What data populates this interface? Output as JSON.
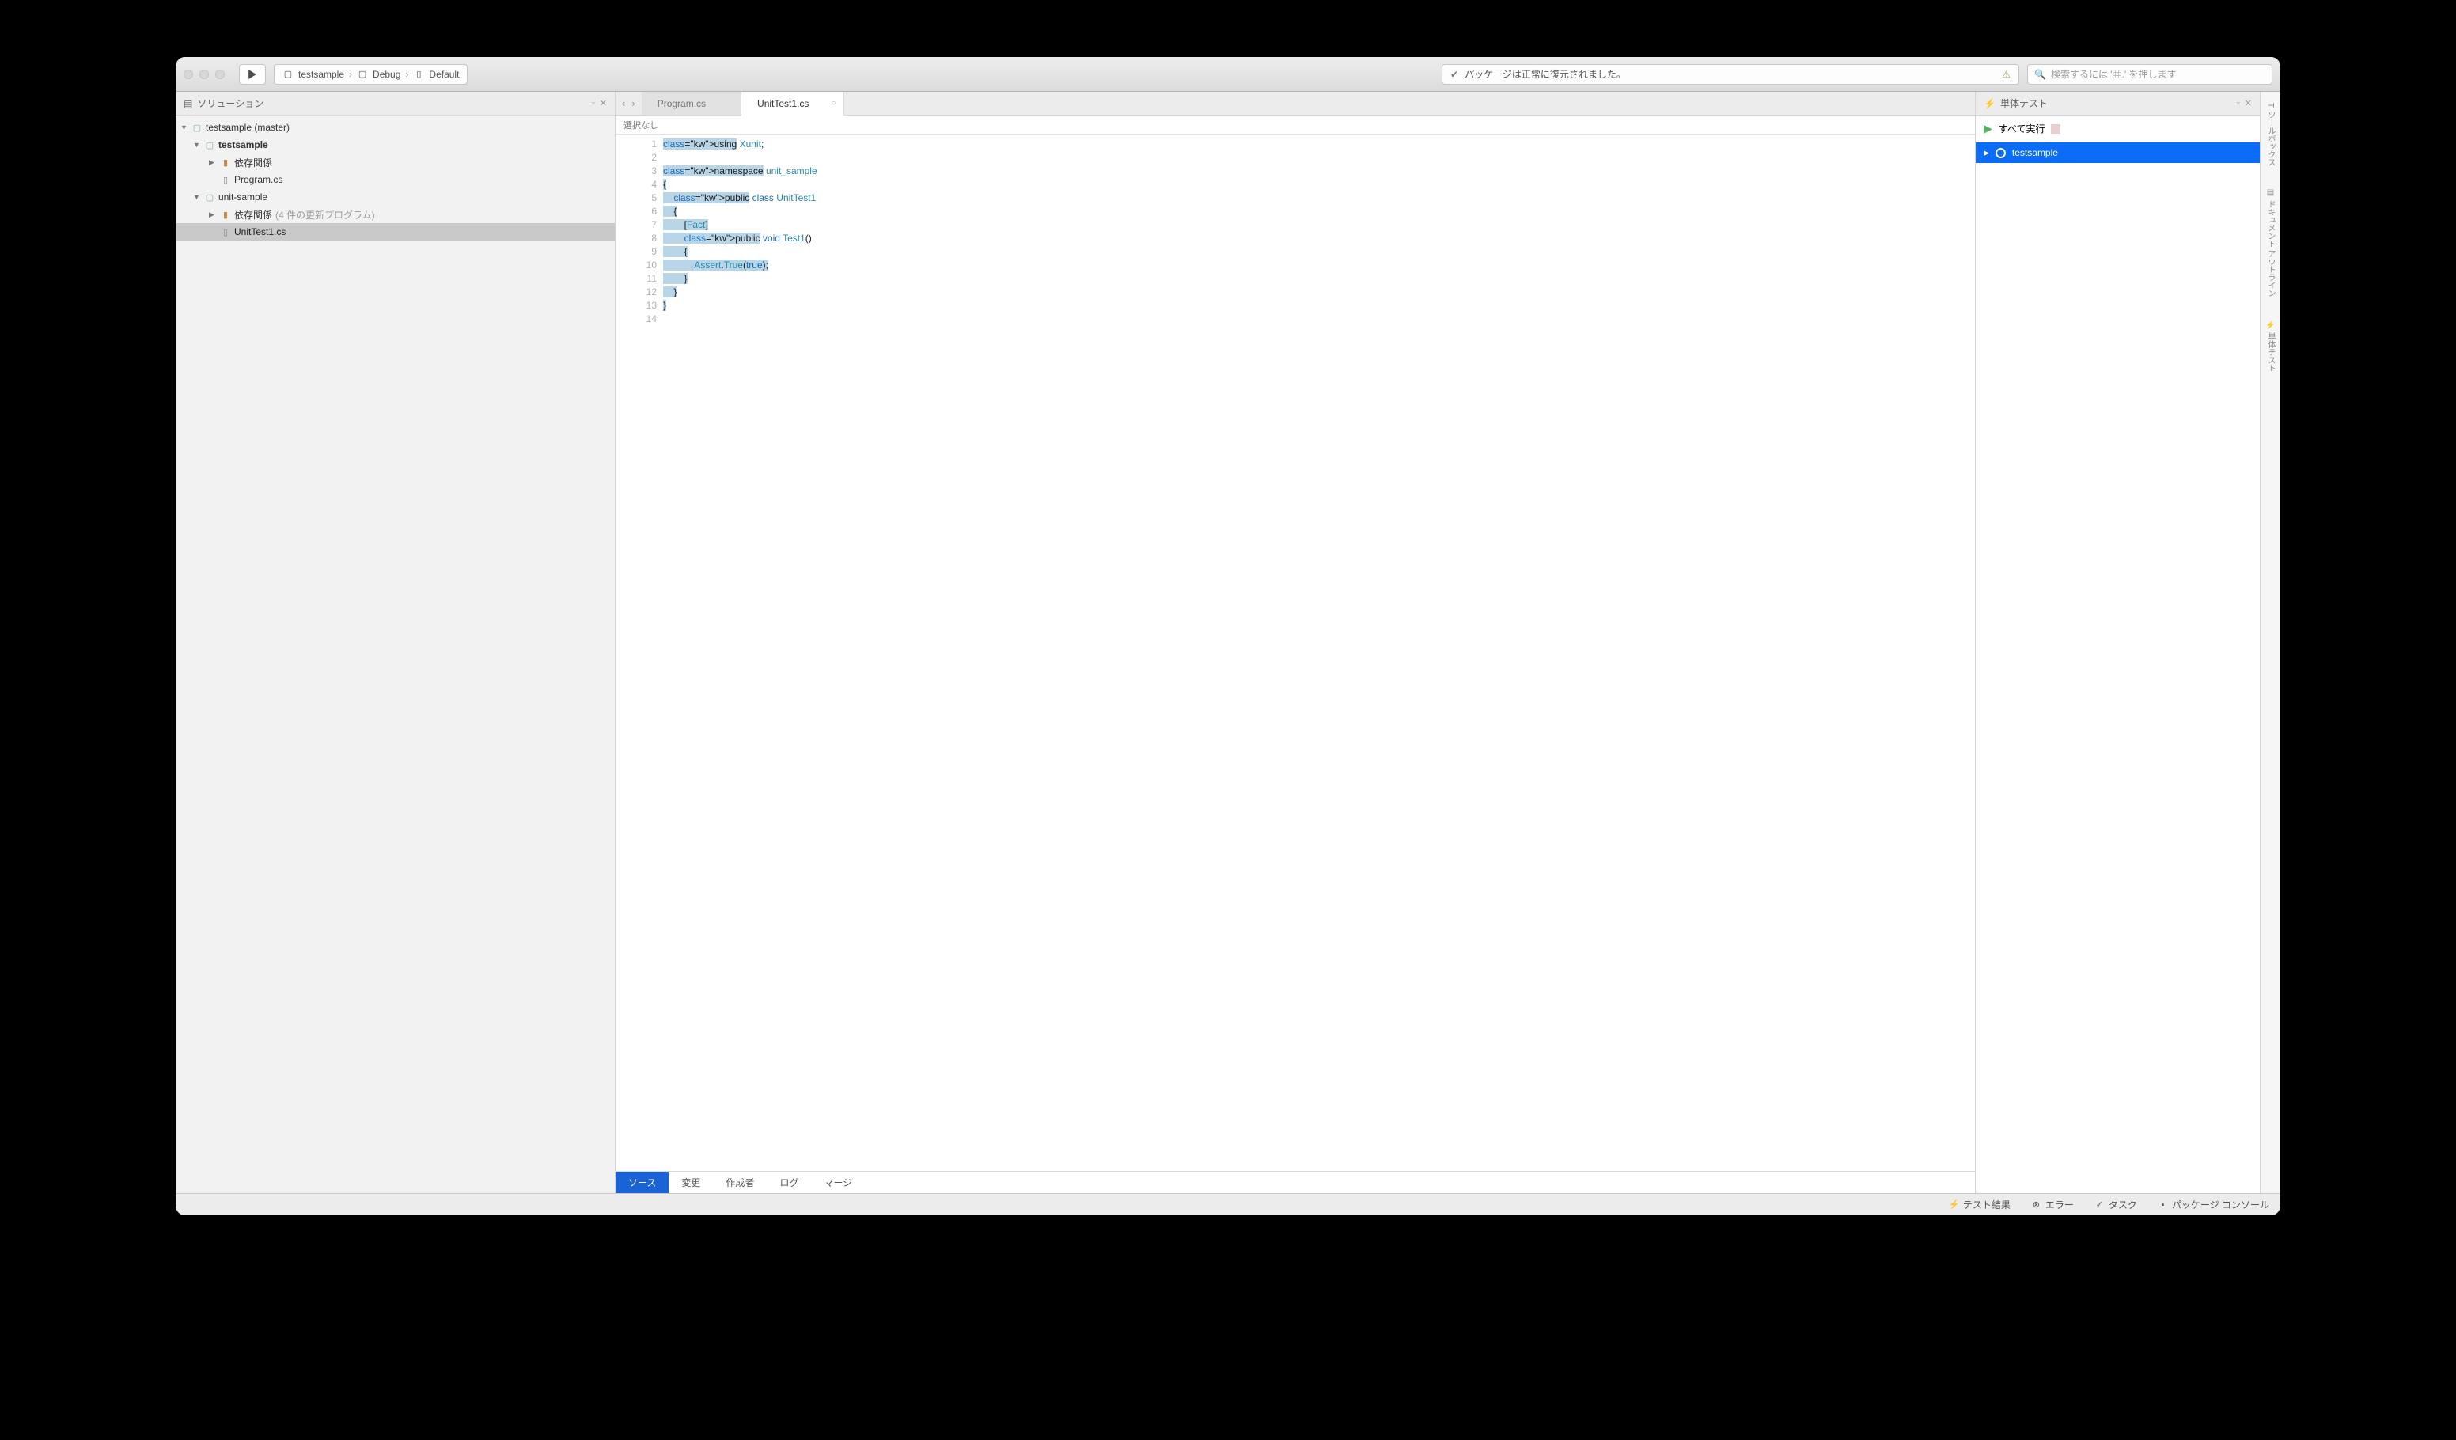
{
  "toolbar": {
    "breadcrumbs": [
      "testsample",
      "Debug",
      "Default"
    ],
    "status_text": "パッケージは正常に復元されました。",
    "search_placeholder": "検索するには '⌘.' を押します"
  },
  "solution_panel": {
    "title": "ソリューション",
    "tree": {
      "root": "testsample (master)",
      "proj1": "testsample",
      "proj1_deps": "依存関係",
      "proj1_file": "Program.cs",
      "proj2": "unit-sample",
      "proj2_deps": "依存関係",
      "proj2_deps_note": "(4 件の更新プログラム)",
      "proj2_file": "UnitTest1.cs"
    }
  },
  "editor": {
    "nav_crumb": "選択なし",
    "tabs": [
      {
        "label": "Program.cs",
        "active": false
      },
      {
        "label": "UnitTest1.cs",
        "active": true
      }
    ],
    "code_lines": [
      "using Xunit;",
      "",
      "namespace unit_sample",
      "{",
      "    public class UnitTest1",
      "    {",
      "        [Fact]",
      "        public void Test1()",
      "        {",
      "            Assert.True(true);",
      "        }",
      "    }",
      "}",
      ""
    ],
    "bottom_tabs": [
      "ソース",
      "変更",
      "作成者",
      "ログ",
      "マージ"
    ]
  },
  "test_panel": {
    "title": "単体テスト",
    "run_all_label": "すべて実行",
    "test_item": "testsample"
  },
  "right_rail": {
    "tabs": [
      "ツールボックス",
      "ドキュメント アウトライン",
      "単体テスト"
    ]
  },
  "status_bar": {
    "items": [
      "テスト結果",
      "エラー",
      "タスク",
      "パッケージ コンソール"
    ]
  }
}
